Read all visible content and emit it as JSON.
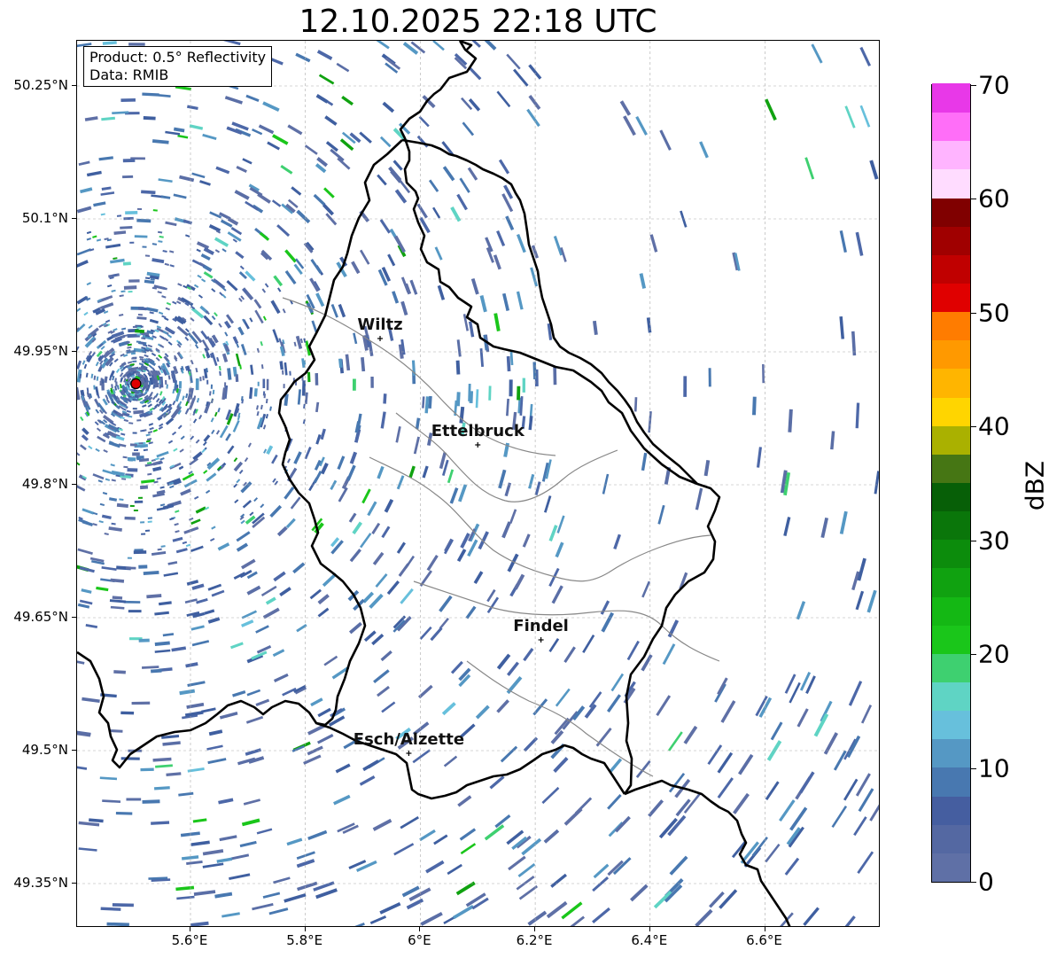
{
  "title": "12.10.2025 22:18 UTC",
  "info": {
    "product": "Product: 0.5° Reflectivity",
    "data": "Data: RMIB"
  },
  "lat_labels": [
    "50.25°N",
    "50.1°N",
    "49.95°N",
    "49.8°N",
    "49.65°N",
    "49.5°N",
    "49.35°N"
  ],
  "lon_labels": [
    "5.6°E",
    "5.8°E",
    "6°E",
    "6.2°E",
    "6.4°E",
    "6.6°E"
  ],
  "cities": [
    {
      "name": "Wiltz",
      "lon": 5.93,
      "lat": 49.965
    },
    {
      "name": "Ettelbruck",
      "lon": 6.1,
      "lat": 49.845
    },
    {
      "name": "Findel",
      "lon": 6.21,
      "lat": 49.625
    },
    {
      "name": "Esch/Alzette",
      "lon": 5.98,
      "lat": 49.497
    }
  ],
  "radar_site": {
    "lon": 5.505,
    "lat": 49.914
  },
  "colorbar": {
    "unit": "dBZ",
    "min": 0,
    "max": 70,
    "tick_labels": [
      "0",
      "10",
      "20",
      "30",
      "40",
      "50",
      "60",
      "70"
    ],
    "tick_values": [
      0,
      10,
      20,
      30,
      40,
      50,
      60,
      70
    ],
    "colors": [
      "#5f70a6",
      "#5468a2",
      "#455ea0",
      "#4878b0",
      "#5598c4",
      "#67c0dc",
      "#5fd4c4",
      "#3ed070",
      "#1ac61a",
      "#14b814",
      "#10a210",
      "#0c8c0c",
      "#0a760a",
      "#075f07",
      "#467614",
      "#aab100",
      "#ffd500",
      "#ffb500",
      "#ff9900",
      "#ff7c00",
      "#e00000",
      "#c00000",
      "#a00000",
      "#800000",
      "#ffdcff",
      "#ffb4ff",
      "#ff6ef8",
      "#e838e8"
    ]
  }
}
